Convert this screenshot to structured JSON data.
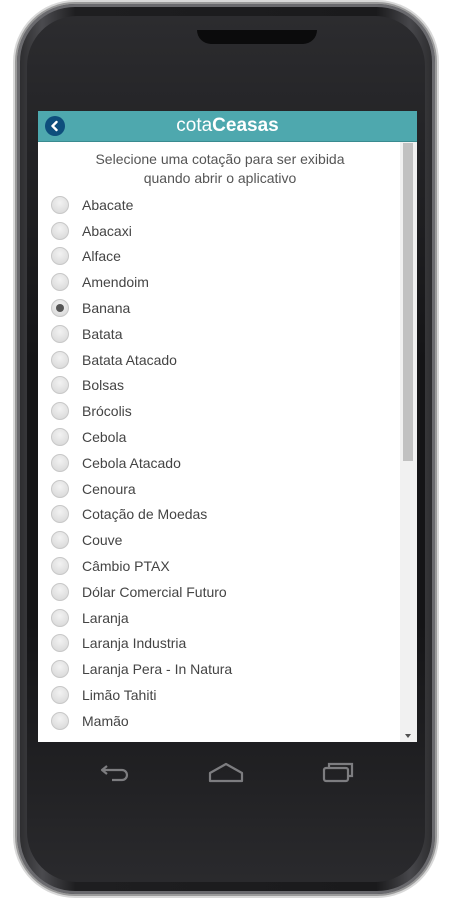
{
  "app": {
    "title_part1": "cota",
    "title_part2": "Ceasas"
  },
  "prompt": {
    "line1": "Selecione uma cotação para ser exibida",
    "line2": "quando abrir o aplicativo"
  },
  "options": [
    {
      "label": "Abacate",
      "checked": false
    },
    {
      "label": "Abacaxi",
      "checked": false
    },
    {
      "label": "Alface",
      "checked": false
    },
    {
      "label": "Amendoim",
      "checked": false
    },
    {
      "label": "Banana",
      "checked": true
    },
    {
      "label": "Batata",
      "checked": false
    },
    {
      "label": "Batata Atacado",
      "checked": false
    },
    {
      "label": "Bolsas",
      "checked": false
    },
    {
      "label": "Brócolis",
      "checked": false
    },
    {
      "label": "Cebola",
      "checked": false
    },
    {
      "label": "Cebola Atacado",
      "checked": false
    },
    {
      "label": "Cenoura",
      "checked": false
    },
    {
      "label": "Cotação de Moedas",
      "checked": false
    },
    {
      "label": "Couve",
      "checked": false
    },
    {
      "label": "Câmbio PTAX",
      "checked": false
    },
    {
      "label": "Dólar Comercial Futuro",
      "checked": false
    },
    {
      "label": "Laranja",
      "checked": false
    },
    {
      "label": "Laranja Industria",
      "checked": false
    },
    {
      "label": "Laranja Pera - In Natura",
      "checked": false
    },
    {
      "label": "Limão Tahiti",
      "checked": false
    },
    {
      "label": "Mamão",
      "checked": false
    }
  ],
  "colors": {
    "header": "#4ea8ae",
    "back_button": "#0e4e7c"
  },
  "icons": {
    "back": "chevron-left-icon",
    "nav_back": "back-arrow-icon",
    "nav_home": "home-icon",
    "nav_recent": "recent-apps-icon"
  }
}
